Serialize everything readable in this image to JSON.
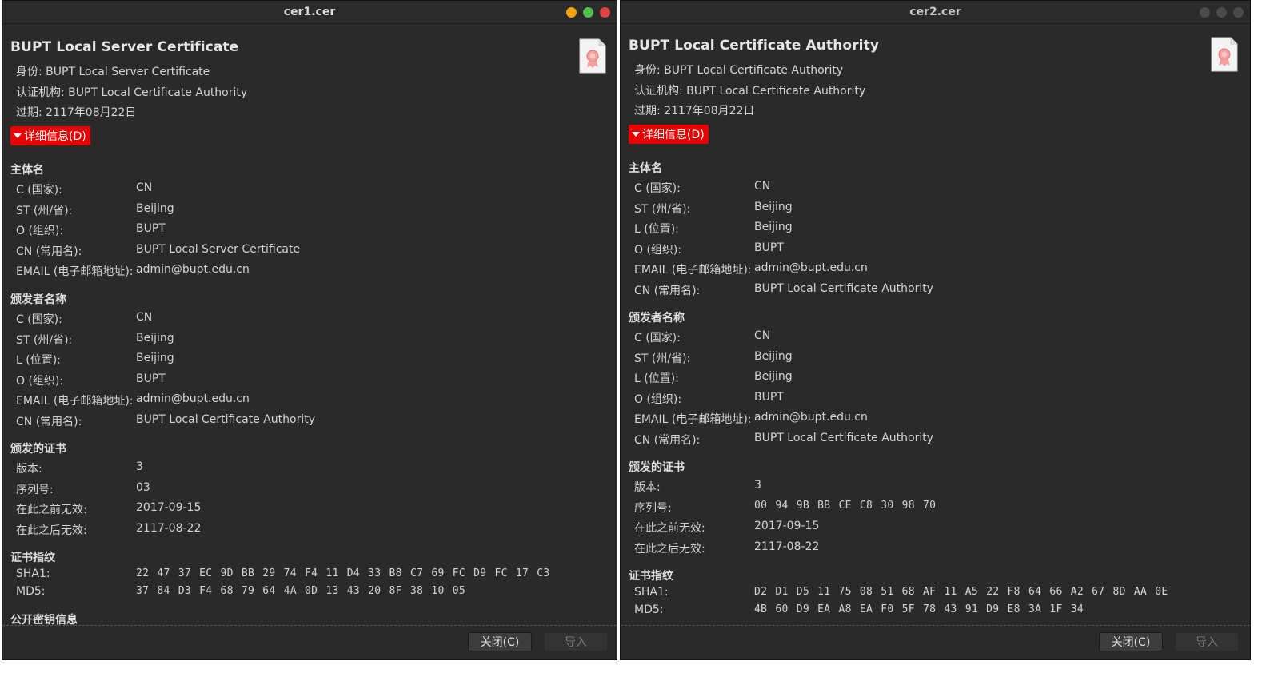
{
  "win1": {
    "title": "cer1.cer",
    "controls": [
      "#f0a30a",
      "#4ec24a",
      "#e04343"
    ],
    "cert_title": "BUPT Local Server Certificate",
    "identity": "身份: BUPT Local Server Certificate",
    "issuer": "认证机构: BUPT Local Certificate Authority",
    "expires": "过期: 2117年08月22日",
    "details_label": "详细信息(D)",
    "subject_heading": "主体名",
    "subject": [
      {
        "k": "C (国家):",
        "v": "CN"
      },
      {
        "k": "ST (州/省):",
        "v": "Beijing"
      },
      {
        "k": "O (组织):",
        "v": "BUPT"
      },
      {
        "k": "CN (常用名):",
        "v": "BUPT Local Server Certificate"
      },
      {
        "k": "EMAIL (电子邮箱地址):",
        "v": "admin@bupt.edu.cn"
      }
    ],
    "issuer_heading": "颁发者名称",
    "issuer_fields": [
      {
        "k": "C (国家):",
        "v": "CN"
      },
      {
        "k": "ST (州/省):",
        "v": "Beijing"
      },
      {
        "k": "L (位置):",
        "v": "Beijing"
      },
      {
        "k": "O (组织):",
        "v": "BUPT"
      },
      {
        "k": "EMAIL (电子邮箱地址):",
        "v": "admin@bupt.edu.cn"
      },
      {
        "k": "CN (常用名):",
        "v": "BUPT Local Certificate Authority"
      }
    ],
    "issued_heading": "颁发的证书",
    "issued": [
      {
        "k": "版本:",
        "v": "3"
      },
      {
        "k": "序列号:",
        "v": "03"
      },
      {
        "k": "在此之前无效:",
        "v": "2017-09-15"
      },
      {
        "k": "在此之后无效:",
        "v": "2117-08-22"
      }
    ],
    "fp_heading": "证书指纹",
    "fingerprints": [
      {
        "k": "SHA1:",
        "v": "22 47 37 EC 9D BB 29 74 F4 11 D4 33 B8 C7 69 FC D9 FC 17 C3"
      },
      {
        "k": "MD5:",
        "v": "37 84 D3 F4 68 79 64 4A 0D 13 43 20 8F 38 10 05"
      }
    ],
    "pubkey_heading": "公开密钥信息",
    "close_label": "关闭(C)",
    "import_label": "导入"
  },
  "win2": {
    "title": "cer2.cer",
    "controls": [
      "#4a4a4a",
      "#4a4a4a",
      "#4a4a4a"
    ],
    "cert_title": "BUPT Local Certificate Authority",
    "identity": "身份: BUPT Local Certificate Authority",
    "issuer": "认证机构: BUPT Local Certificate Authority",
    "expires": "过期: 2117年08月22日",
    "details_label": "详细信息(D)",
    "subject_heading": "主体名",
    "subject": [
      {
        "k": "C (国家):",
        "v": "CN"
      },
      {
        "k": "ST (州/省):",
        "v": "Beijing"
      },
      {
        "k": "L (位置):",
        "v": "Beijing"
      },
      {
        "k": "O (组织):",
        "v": "BUPT"
      },
      {
        "k": "EMAIL (电子邮箱地址):",
        "v": "admin@bupt.edu.cn"
      },
      {
        "k": "CN (常用名):",
        "v": "BUPT Local Certificate Authority"
      }
    ],
    "issuer_heading": "颁发者名称",
    "issuer_fields": [
      {
        "k": "C (国家):",
        "v": "CN"
      },
      {
        "k": "ST (州/省):",
        "v": "Beijing"
      },
      {
        "k": "L (位置):",
        "v": "Beijing"
      },
      {
        "k": "O (组织):",
        "v": "BUPT"
      },
      {
        "k": "EMAIL (电子邮箱地址):",
        "v": "admin@bupt.edu.cn"
      },
      {
        "k": "CN (常用名):",
        "v": "BUPT Local Certificate Authority"
      }
    ],
    "issued_heading": "颁发的证书",
    "issued": [
      {
        "k": "版本:",
        "v": "3"
      },
      {
        "k": "序列号:",
        "v": "00 94 9B BB CE C8 30 98 70"
      },
      {
        "k": "在此之前无效:",
        "v": "2017-09-15"
      },
      {
        "k": "在此之后无效:",
        "v": "2117-08-22"
      }
    ],
    "fp_heading": "证书指纹",
    "fingerprints": [
      {
        "k": "SHA1:",
        "v": "D2 D1 D5 11 75 08 51 68 AF 11 A5 22 F8 64 66 A2 67 8D AA 0E"
      },
      {
        "k": "MD5:",
        "v": "4B 60 D9 EA A8 EA F0 5F 78 43 91 D9 E8 3A 1F 34"
      }
    ],
    "close_label": "关闭(C)",
    "import_label": "导入"
  }
}
